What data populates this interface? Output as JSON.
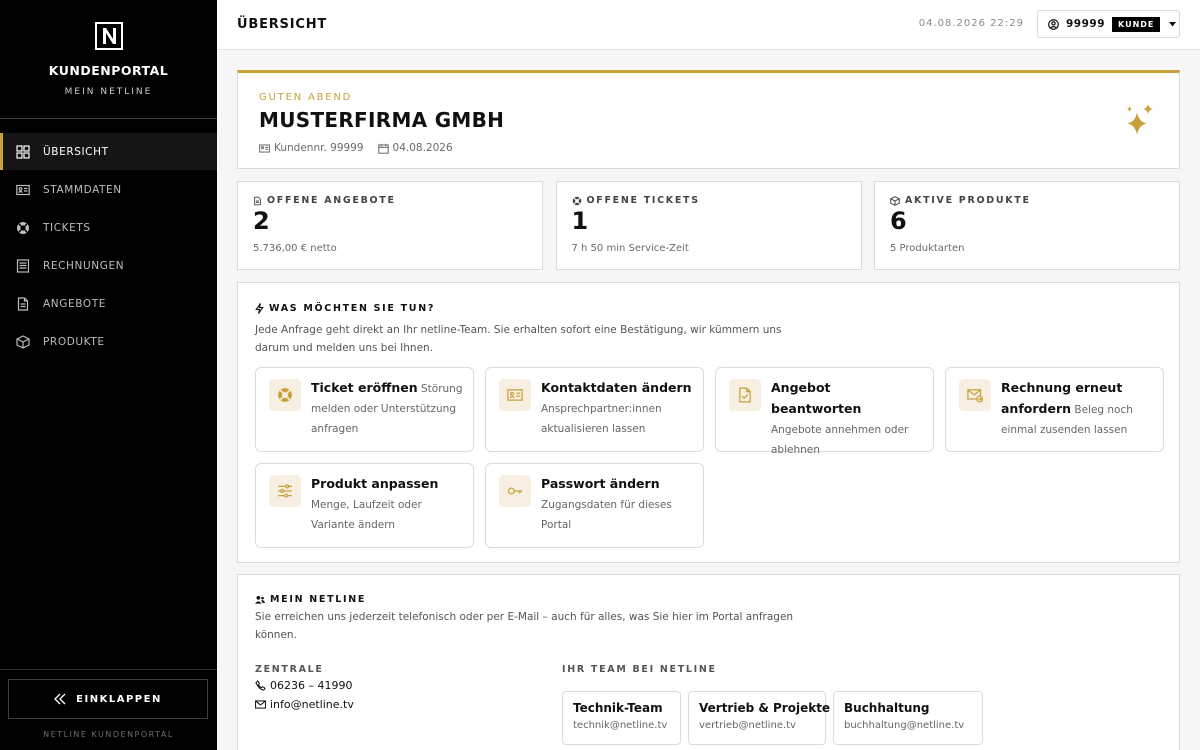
{
  "sidebar": {
    "brand_title": "KUNDENPORTAL",
    "brand_subtitle": "MEIN NETLINE",
    "items": [
      {
        "label": "ÜBERSICHT",
        "icon": "grid-icon"
      },
      {
        "label": "STAMMDATEN",
        "icon": "id-card-icon"
      },
      {
        "label": "TICKETS",
        "icon": "lifebuoy-icon"
      },
      {
        "label": "RECHNUNGEN",
        "icon": "receipt-icon"
      },
      {
        "label": "ANGEBOTE",
        "icon": "document-icon"
      },
      {
        "label": "PRODUKTE",
        "icon": "box-icon"
      }
    ],
    "active_index": 0,
    "collapse_label": "EINKLAPPEN",
    "footer": "NETLINE KUNDENPORTAL"
  },
  "header": {
    "title": "ÜBERSICHT",
    "datetime": "04.08.2026 22:29",
    "user_number": "99999",
    "user_role": "KUNDE"
  },
  "welcome": {
    "greeting": "GUTEN ABEND",
    "company": "MUSTERFIRMA GMBH",
    "customer_number": "Kundennr. 99999",
    "date": "04.08.2026"
  },
  "stats": [
    {
      "label": "OFFENE ANGEBOTE",
      "value": "2",
      "sub": "5.736,00 € netto",
      "icon": "document-icon"
    },
    {
      "label": "OFFENE TICKETS",
      "value": "1",
      "sub": "7 h 50 min Service-Zeit",
      "icon": "lifebuoy-icon"
    },
    {
      "label": "AKTIVE PRODUKTE",
      "value": "6",
      "sub": "5 Produktarten",
      "icon": "box-icon"
    }
  ],
  "actions": {
    "label": "WAS MÖCHTEN SIE TUN?",
    "description": "Jede Anfrage geht direkt an Ihr netline-Team. Sie erhalten sofort eine Bestätigung, wir kümmern uns darum und melden uns bei Ihnen.",
    "tiles": [
      {
        "title": "Ticket eröffnen",
        "desc": "Störung melden oder Unterstützung anfragen",
        "icon": "lifebuoy-icon"
      },
      {
        "title": "Kontaktdaten ändern",
        "desc": "Ansprechpartner:innen aktualisieren lassen",
        "icon": "id-card-icon"
      },
      {
        "title": "Angebot beantworten",
        "desc": "Angebote annehmen oder ablehnen",
        "icon": "document-check-icon"
      },
      {
        "title": "Rechnung erneut anfordern",
        "desc": "Beleg noch einmal zusenden lassen",
        "icon": "mail-resend-icon"
      },
      {
        "title": "Produkt anpassen",
        "desc": "Menge, Laufzeit oder Variante ändern",
        "icon": "sliders-icon"
      },
      {
        "title": "Passwort ändern",
        "desc": "Zugangsdaten für dieses Portal",
        "icon": "key-icon"
      }
    ]
  },
  "contact": {
    "label": "MEIN NETLINE",
    "description": "Sie erreichen uns jederzeit telefonisch oder per E-Mail – auch für alles, was Sie hier im Portal anfragen können.",
    "central_label": "ZENTRALE",
    "phone": "06236 – 41990",
    "email": "info@netline.tv",
    "team_label": "IHR TEAM BEI NETLINE",
    "team": [
      {
        "name": "Technik-Team",
        "email": "technik@netline.tv"
      },
      {
        "name": "Vertrieb & Projekte",
        "email": "vertrieb@netline.tv"
      },
      {
        "name": "Buchhaltung",
        "email": "buchhaltung@netline.tv"
      }
    ]
  },
  "colors": {
    "accent": "#c9a13b",
    "sidebar": "#000000",
    "tile_icon_bg": "#f6efe2"
  }
}
